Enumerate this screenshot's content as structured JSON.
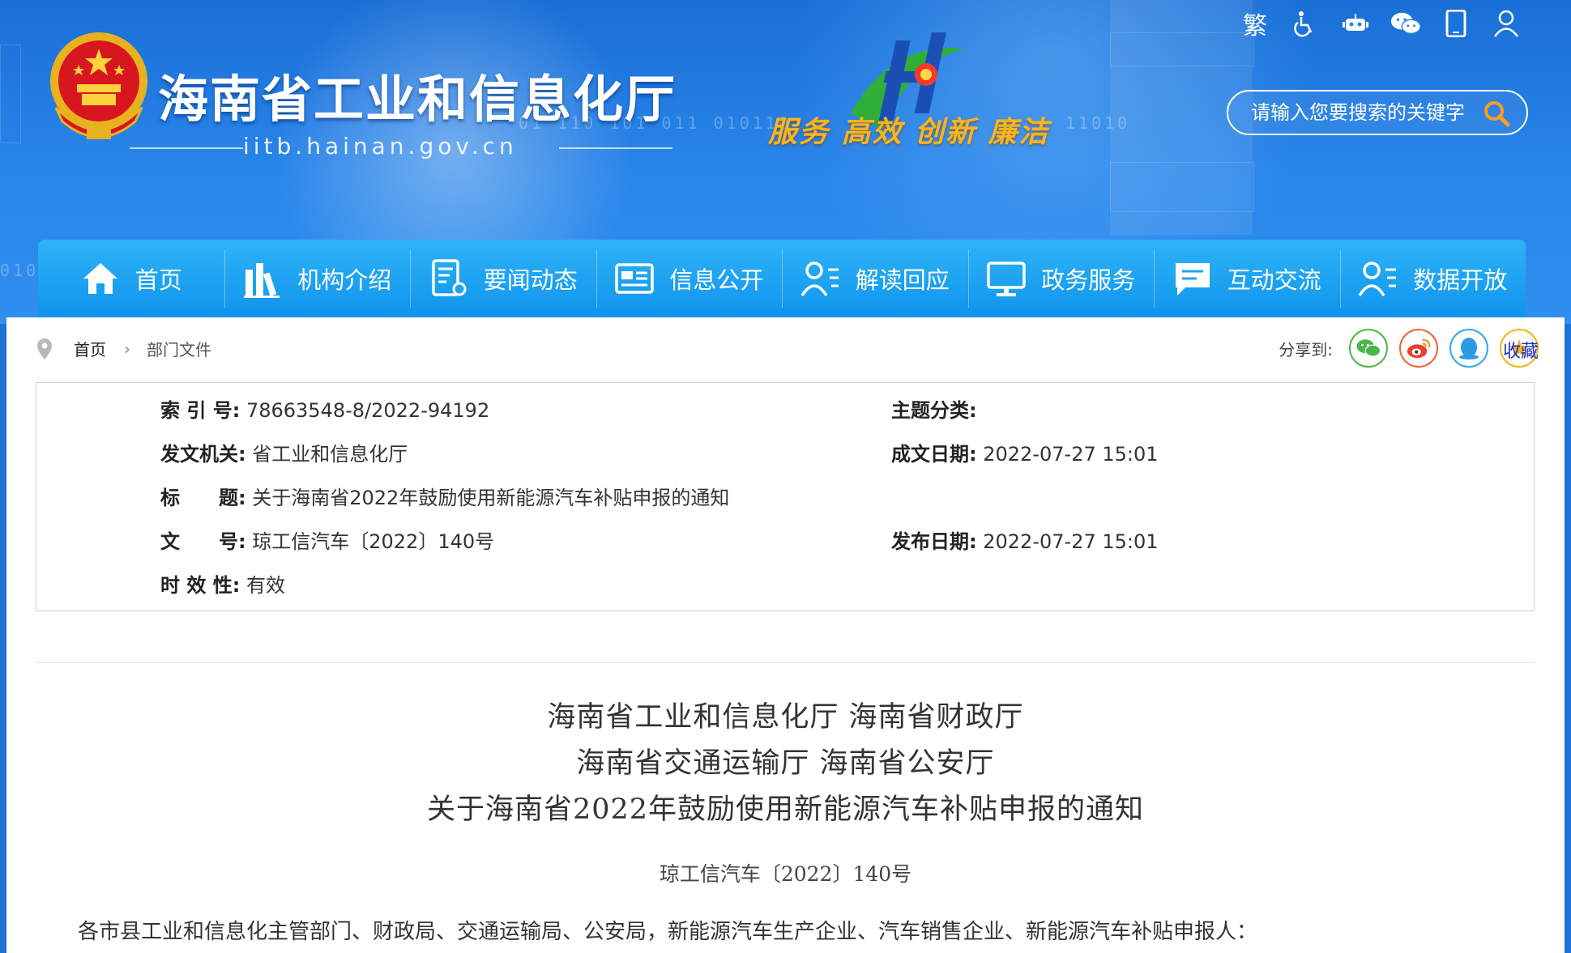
{
  "header": {
    "site_title": "海南省工业和信息化厅",
    "site_url": "iitb.hainan.gov.cn",
    "slogan": "服务 高效 创新 廉洁",
    "binary_text": "01 110 101 011 010110",
    "binary_text_right": "11010",
    "binary_text_left": "010",
    "tools": [
      {
        "name": "traditional-chinese",
        "label": "繁"
      },
      {
        "name": "accessibility-icon"
      },
      {
        "name": "robot-icon"
      },
      {
        "name": "wechat-icon"
      },
      {
        "name": "mobile-icon"
      },
      {
        "name": "user-icon"
      }
    ],
    "search_placeholder": "请输入您要搜索的关键字"
  },
  "nav": {
    "items": [
      {
        "label": "首页",
        "icon": "home-icon"
      },
      {
        "label": "机构介绍",
        "icon": "books-icon"
      },
      {
        "label": "要闻动态",
        "icon": "document-gear-icon"
      },
      {
        "label": "信息公开",
        "icon": "newspaper-icon"
      },
      {
        "label": "解读回应",
        "icon": "person-list-icon"
      },
      {
        "label": "政务服务",
        "icon": "monitor-icon"
      },
      {
        "label": "互动交流",
        "icon": "chat-icon"
      },
      {
        "label": "数据开放",
        "icon": "person-data-icon"
      }
    ]
  },
  "breadcrumb": {
    "home": "首页",
    "current": "部门文件"
  },
  "share": {
    "label": "分享到:",
    "favorite": "收藏"
  },
  "meta": {
    "index_no": {
      "key": "索 引 号:",
      "value": "78663548-8/2022-94192"
    },
    "subject": {
      "key": "主题分类:",
      "value": ""
    },
    "issuer": {
      "key": "发文机关:",
      "value": "省工业和信息化厅"
    },
    "written_date": {
      "key": "成文日期:",
      "value": "2022-07-27 15:01"
    },
    "title": {
      "key": "标　　题:",
      "value": "关于海南省2022年鼓励使用新能源汽车补贴申报的通知"
    },
    "doc_no": {
      "key": "文　　号:",
      "value": "琼工信汽车〔2022〕140号"
    },
    "publish_date": {
      "key": "发布日期:",
      "value": "2022-07-27 15:01"
    },
    "validity": {
      "key": "时 效 性:",
      "value": "有效"
    }
  },
  "document": {
    "title_line1": "海南省工业和信息化厅  海南省财政厅",
    "title_line2": "海南省交通运输厅  海南省公安厅",
    "title_line3": "关于海南省2022年鼓励使用新能源汽车补贴申报的通知",
    "doc_no": "琼工信汽车〔2022〕140号",
    "body_first_line": "各市县工业和信息化主管部门、财政局、交通运输局、公安局，新能源汽车生产企业、汽车销售企业、新能源汽车补贴申报人："
  },
  "colors": {
    "nav_top": "#2fb3f6",
    "nav_bottom": "#0f94ee",
    "header_blue": "#1a6fd6",
    "slogan": "#ffb418"
  }
}
